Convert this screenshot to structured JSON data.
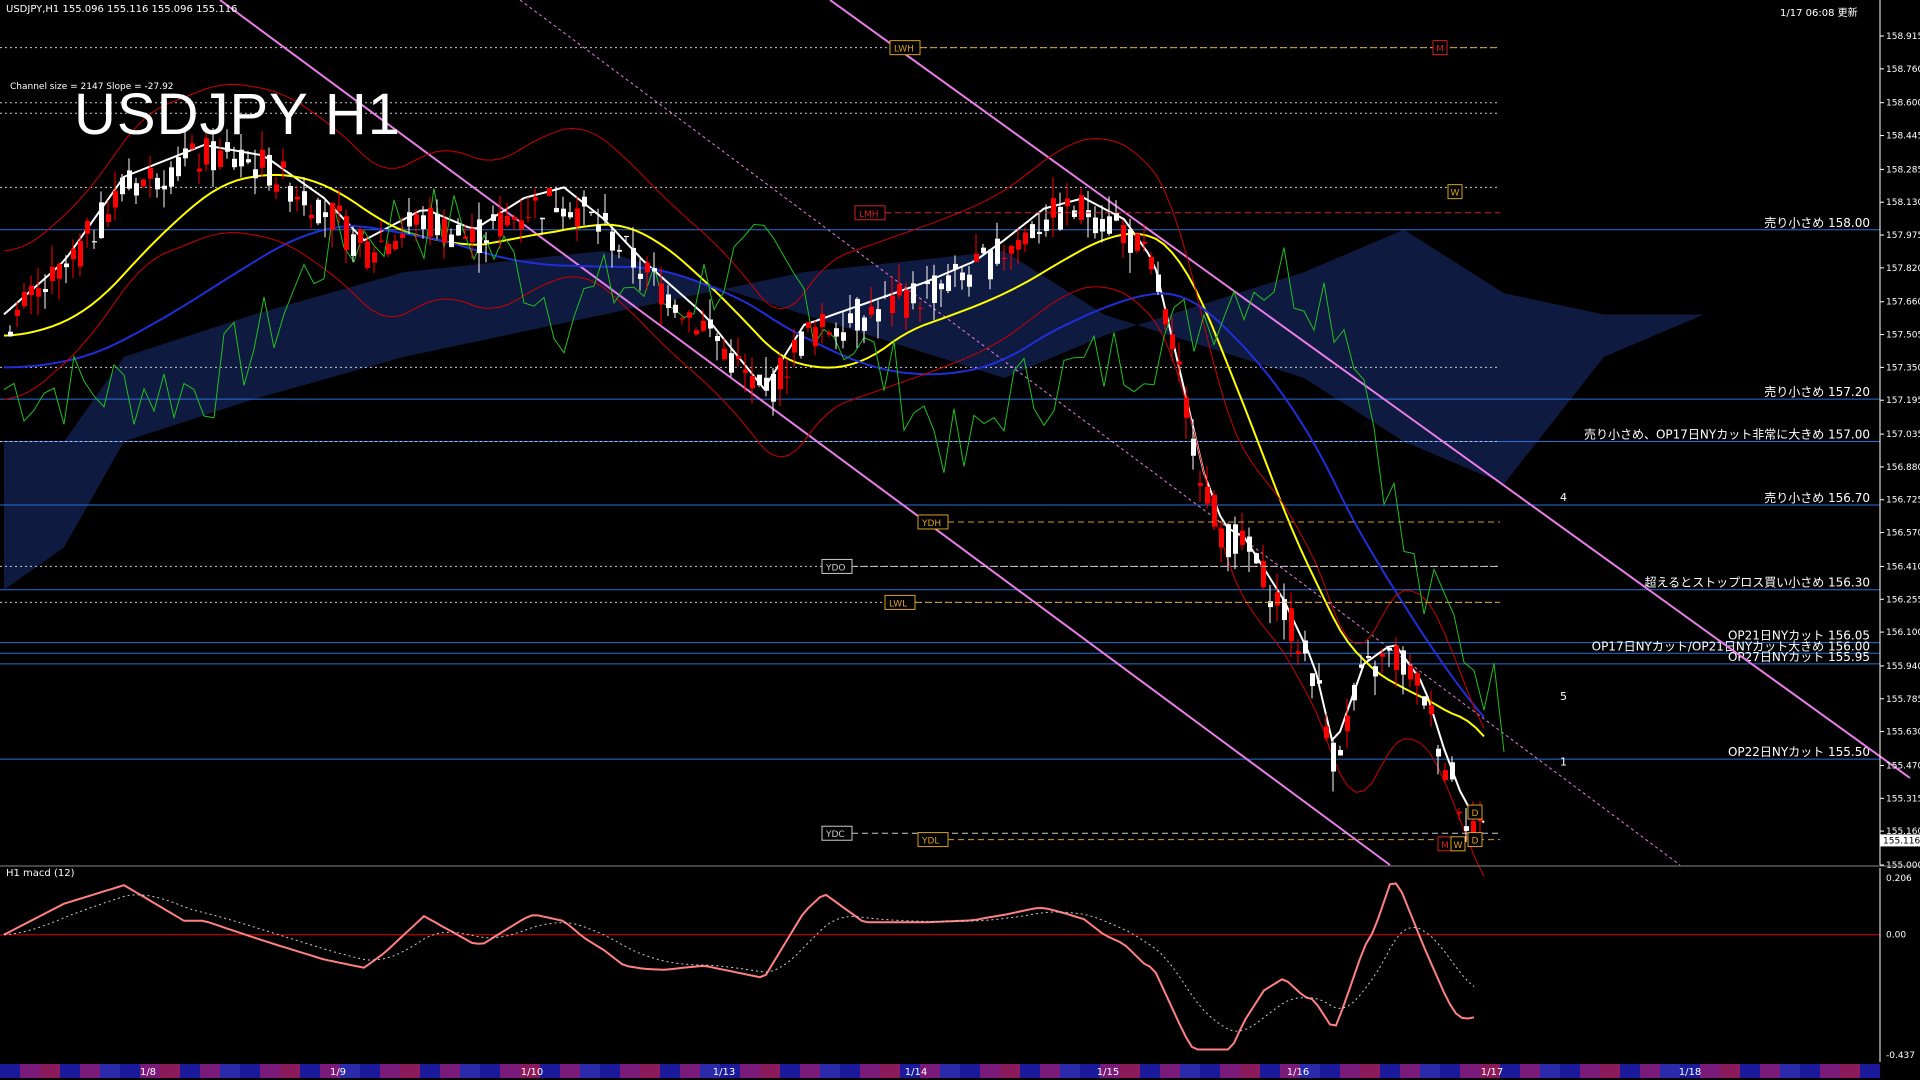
{
  "header": {
    "symbol_info": "USDJPY,H1  155.096 155.116 155.096 155.116",
    "datetime": "1/17 06:08 更新"
  },
  "chart_title": "USDJPY H1",
  "channel_info": "Channel size = 2147 Slope = -27.92",
  "current_price": "155.116",
  "macd_label": "H1  macd (12)",
  "colors": {
    "background": "#000000",
    "bull_candle": "#ffffff",
    "bear_candle": "#ff0000",
    "ma_white": "#ffffff",
    "ma_yellow": "#ffff00",
    "ma_blue": "#1f2fd8",
    "channel_line": "#e87de8",
    "level_line": "#2a6fd8",
    "bb_red": "#cc0000",
    "green_line": "#1fbf1f",
    "cloud": "#2a4ab8",
    "macd_main": "#ff8080",
    "macd_green": "#22dd22"
  },
  "chart_data": {
    "type": "candlestick",
    "title": "USDJPY H1",
    "ylim": [
      155.0,
      159.0
    ],
    "y_ticks": [
      "158.915",
      "158.760",
      "158.600",
      "158.445",
      "158.285",
      "158.130",
      "157.975",
      "157.820",
      "157.660",
      "157.505",
      "157.350",
      "157.195",
      "157.035",
      "156.880",
      "156.725",
      "156.570",
      "156.410",
      "156.255",
      "156.100",
      "155.940",
      "155.785",
      "155.630",
      "155.470",
      "155.315",
      "155.160",
      "155.000"
    ],
    "x_labels": [
      "1/8",
      "1/9",
      "1/10",
      "1/13",
      "1/14",
      "1/15",
      "1/16",
      "1/17",
      "1/18"
    ],
    "key_levels": [
      {
        "price": 158.0,
        "label": "売り小さめ 158.00"
      },
      {
        "price": 157.2,
        "label": "売り小さめ 157.20"
      },
      {
        "price": 157.0,
        "label": "売り小さめ、OP17日NYカット非常に大きめ 157.00"
      },
      {
        "price": 156.7,
        "label": "売り小さめ 156.70"
      },
      {
        "price": 156.3,
        "label": "超えるとストップロス買い小さめ 156.30"
      },
      {
        "price": 156.05,
        "label": "OP21日NYカット 156.05"
      },
      {
        "price": 156.0,
        "label": "OP17日NYカット/OP21日NYカット大きめ 156.00"
      },
      {
        "price": 155.95,
        "label": "OP27日NYカット 155.95"
      },
      {
        "price": 155.5,
        "label": "OP22日NYカット 155.50"
      }
    ],
    "ref_boxes": [
      {
        "label": "LWH",
        "price": 158.86
      },
      {
        "label": "LMH",
        "price": 158.08
      },
      {
        "label": "YDH",
        "price": 156.62
      },
      {
        "label": "YDO",
        "price": 156.41
      },
      {
        "label": "LWL",
        "price": 156.24
      },
      {
        "label": "YDC",
        "price": 155.15
      },
      {
        "label": "YDL",
        "price": 155.12
      }
    ],
    "wave_labels": [
      "4",
      "5",
      "1"
    ],
    "marker_letters": [
      "M",
      "W",
      "D",
      "D",
      "M",
      "W"
    ],
    "macd": {
      "name": "macd (12)",
      "ylim": [
        -0.437,
        0.206
      ],
      "y_ticks": [
        "0.206",
        "0.00",
        "-0.437"
      ]
    }
  }
}
